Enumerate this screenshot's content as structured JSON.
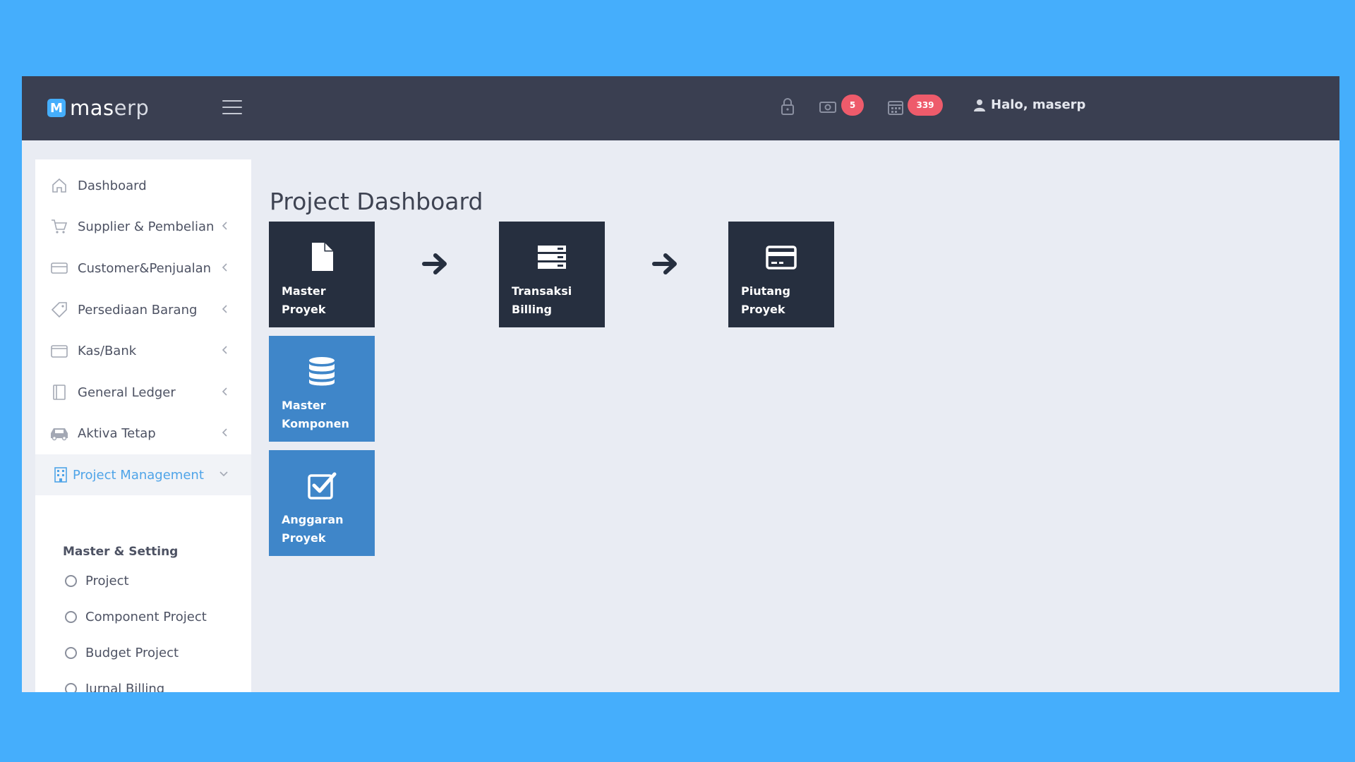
{
  "brand": {
    "badge": "M",
    "name_bold": "mas",
    "name_light": "erp"
  },
  "header": {
    "notif_count": "5",
    "calendar_count": "339",
    "greeting": "Halo, maserp"
  },
  "sidebar": {
    "items": [
      {
        "label": "Dashboard"
      },
      {
        "label": "Supplier & Pembelian"
      },
      {
        "label": "Customer&Penjualan"
      },
      {
        "label": "Persediaan Barang"
      },
      {
        "label": "Kas/Bank"
      },
      {
        "label": "General Ledger"
      },
      {
        "label": "Aktiva Tetap"
      },
      {
        "label": "Project Management"
      }
    ],
    "submenu_title": "Master & Setting",
    "subitems": [
      {
        "label": "Project"
      },
      {
        "label": "Component Project"
      },
      {
        "label": "Budget Project"
      },
      {
        "label": "Jurnal Billing"
      }
    ]
  },
  "main": {
    "title": "Project Dashboard",
    "tiles": [
      {
        "line1": "Master",
        "line2": "Proyek"
      },
      {
        "line1": "Transaksi",
        "line2": "Billing"
      },
      {
        "line1": "Piutang",
        "line2": "Proyek"
      },
      {
        "line1": "Master",
        "line2": "Komponen"
      },
      {
        "line1": "Anggaran",
        "line2": "Proyek"
      }
    ]
  },
  "colors": {
    "background": "#45aefc",
    "topbar": "#3a3f51",
    "tile_dark": "#262f3f",
    "tile_blue": "#3f86c9",
    "badge": "#ee5b6b",
    "active_nav": "#4fa4e8"
  }
}
